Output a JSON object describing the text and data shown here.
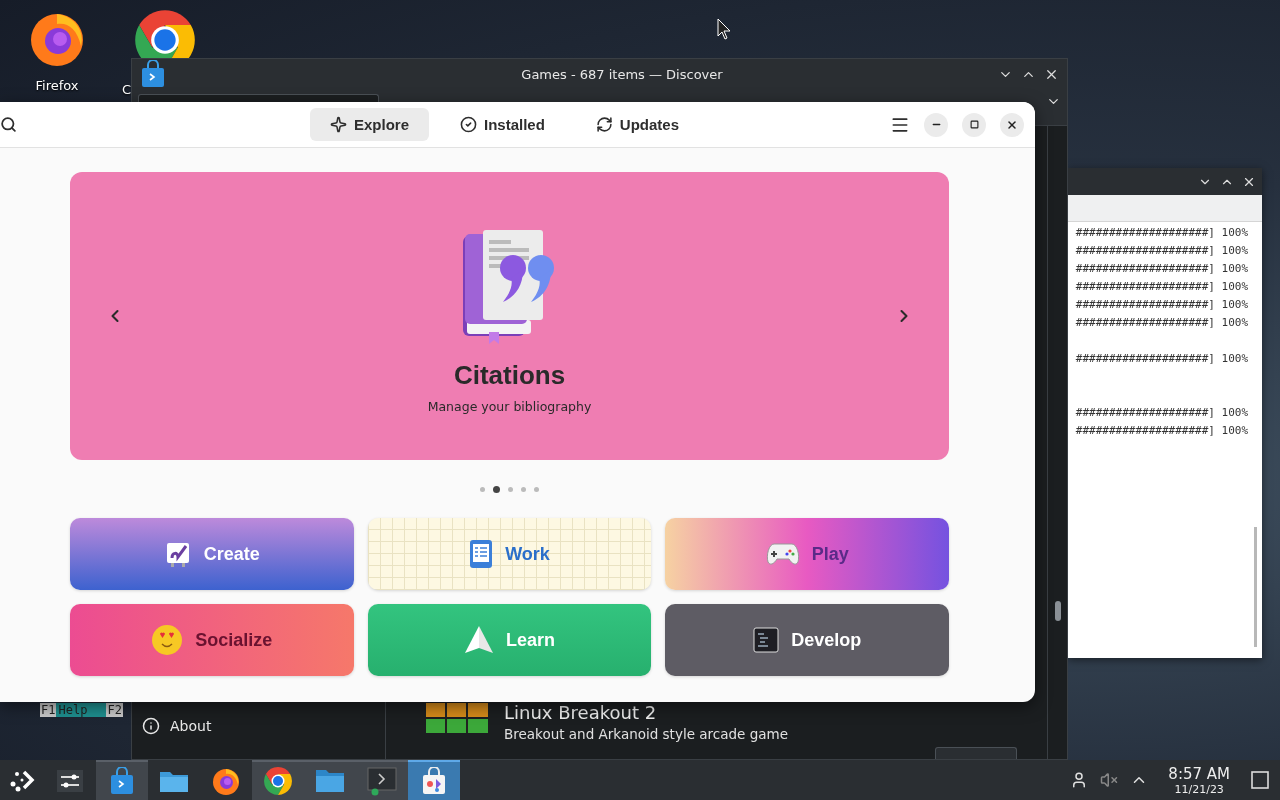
{
  "desktop": {
    "icons": [
      {
        "label": "Firefox",
        "kind": "firefox"
      },
      {
        "label": "C",
        "kind": "chrome"
      }
    ]
  },
  "shell_strip": {
    "keys": [
      {
        "key": "F1",
        "label": "Help"
      },
      {
        "key": "F2"
      }
    ]
  },
  "discover_window": {
    "title": "Games - 687 items — Discover",
    "sidebar": [
      {
        "label": "About",
        "kind": "about"
      }
    ],
    "app": {
      "name": "Linux Breakout 2",
      "summary": "Breakout and Arkanoid style arcade game"
    }
  },
  "terminal": {
    "lines": [
      {
        "kind": "progress",
        "text": "####################] 100%"
      },
      {
        "kind": "progress",
        "text": "####################] 100%"
      },
      {
        "kind": "progress",
        "text": "####################] 100%"
      },
      {
        "kind": "progress",
        "text": "####################] 100%"
      },
      {
        "kind": "progress",
        "text": "####################] 100%"
      },
      {
        "kind": "progress",
        "text": "####################] 100%"
      },
      {
        "kind": "blank"
      },
      {
        "kind": "progress",
        "text": "####################] 100%"
      },
      {
        "kind": "blank"
      },
      {
        "kind": "blank"
      },
      {
        "kind": "progress",
        "text": "####################] 100%"
      },
      {
        "kind": "progress",
        "text": "####################] 100%"
      }
    ]
  },
  "software_window": {
    "tabs": [
      {
        "label": "Explore",
        "selected": true
      },
      {
        "label": "Installed",
        "selected": false
      },
      {
        "label": "Updates",
        "selected": false
      }
    ],
    "banner": {
      "title": "Citations",
      "subtitle": "Manage your bibliography",
      "pages": [
        {
          "selected": false
        },
        {
          "selected": true
        },
        {
          "selected": false
        },
        {
          "selected": false
        },
        {
          "selected": false
        }
      ]
    },
    "categories": [
      {
        "label": "Create",
        "kind": "create"
      },
      {
        "label": "Work",
        "kind": "work"
      },
      {
        "label": "Play",
        "kind": "play"
      },
      {
        "label": "Socialize",
        "kind": "socialize"
      },
      {
        "label": "Learn",
        "kind": "learn"
      },
      {
        "label": "Develop",
        "kind": "develop"
      }
    ]
  },
  "taskbar": {
    "apps": [
      {
        "kind": "settings",
        "running": false,
        "active": false
      },
      {
        "kind": "discover",
        "running": true,
        "active": false
      },
      {
        "kind": "folder",
        "running": false,
        "active": false
      },
      {
        "kind": "firefox",
        "running": false,
        "active": false
      },
      {
        "kind": "chrome",
        "running": true,
        "active": false
      },
      {
        "kind": "files",
        "running": true,
        "active": false
      },
      {
        "kind": "terminal",
        "running": true,
        "active": false
      },
      {
        "kind": "store",
        "running": true,
        "active": true
      }
    ],
    "clock": {
      "time": "8:57 AM",
      "date": "11/21/23"
    }
  }
}
